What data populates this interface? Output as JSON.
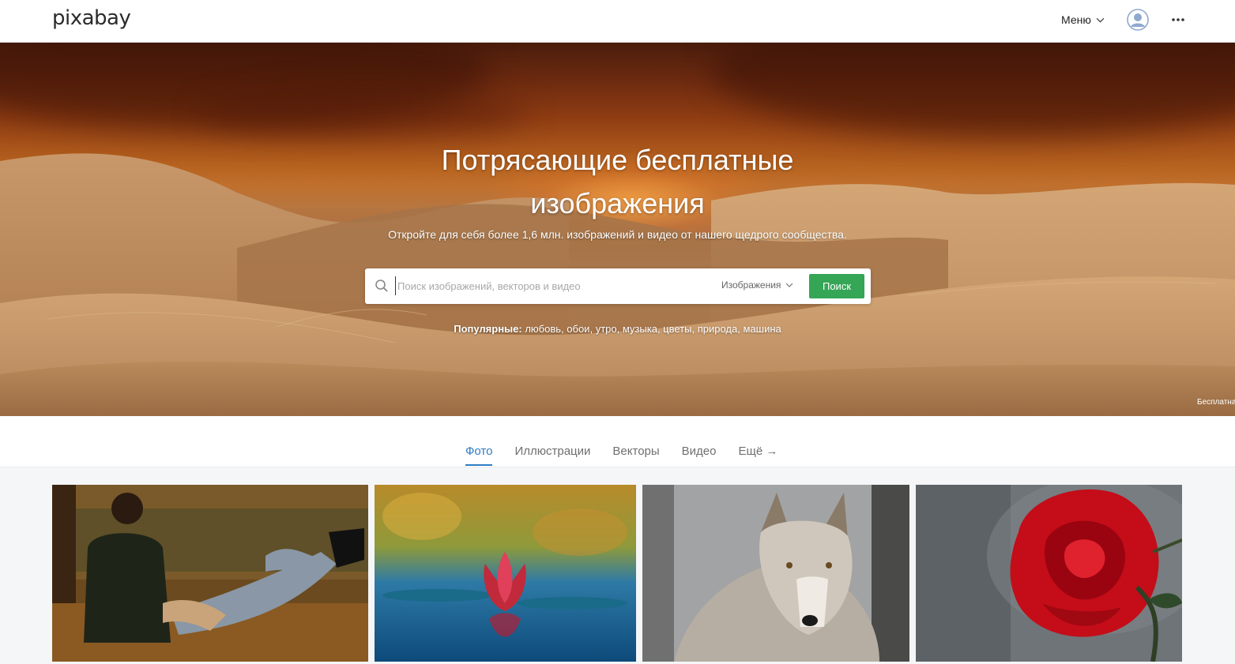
{
  "header": {
    "logo": "pixabay",
    "menu_label": "Меню",
    "icons": {
      "menu_chevron": "chevron-down-icon",
      "avatar": "user-avatar-icon",
      "more": "more-dots-icon"
    }
  },
  "hero": {
    "title_line1": "Потрясающие бесплатные",
    "title_line2": "изображения",
    "subtitle": "Откройте для себя более 1,6 млн. изображений и видео от нашего щедрого сообщества.",
    "credit": "Бесплатна"
  },
  "search": {
    "placeholder": "Поиск изображений, векторов и видео",
    "value": "",
    "type_selected": "Изображения",
    "button_label": "Поиск",
    "button_color": "#35a556"
  },
  "popular": {
    "label": "Популярные:",
    "tags": [
      "любовь",
      "обои",
      "утро",
      "музыка",
      "цветы",
      "природа",
      "машина"
    ]
  },
  "tabs": [
    {
      "label": "Фото",
      "active": true
    },
    {
      "label": "Иллюстрации",
      "active": false
    },
    {
      "label": "Векторы",
      "active": false
    },
    {
      "label": "Видео",
      "active": false
    },
    {
      "label": "Ещё →",
      "active": false
    }
  ],
  "colors": {
    "accent": "#2e7dc4",
    "search_button": "#35a556"
  },
  "photos": [
    {
      "subject": "couple-autumn-park-photo"
    },
    {
      "subject": "water-lily-photo"
    },
    {
      "subject": "wolf-photo"
    },
    {
      "subject": "red-rose-photo"
    }
  ]
}
